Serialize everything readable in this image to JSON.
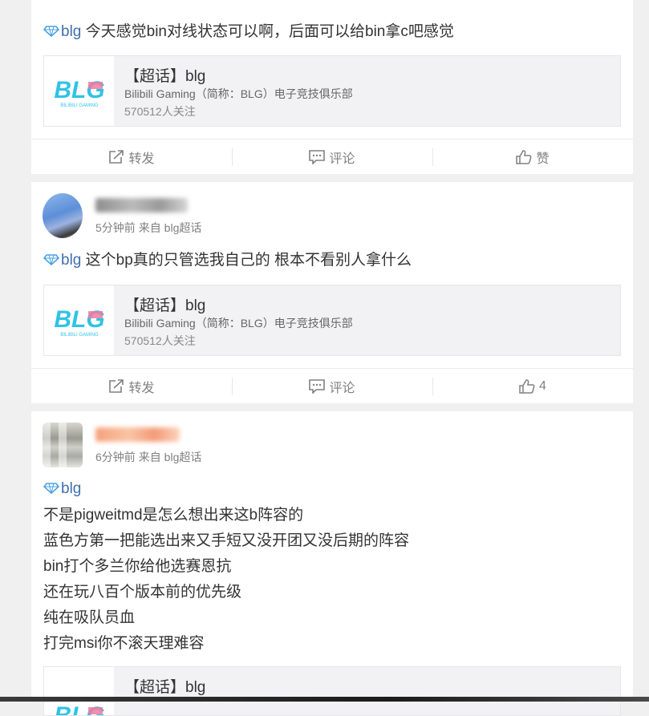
{
  "posts": [
    {
      "topic": "blg",
      "text": "今天感觉bin对线状态可以啊，后面可以给bin拿c吧感觉",
      "share": {
        "title": "【超话】blg",
        "desc": "Bilibili Gaming（简称：BLG）电子竞技俱乐部",
        "count": "570512人关注",
        "logo_text": "BLG",
        "logo_sub": "BILIBILI GAMING"
      },
      "actions": {
        "repost": "转发",
        "comment": "评论",
        "like": "赞"
      }
    },
    {
      "time": "5分钟前",
      "source": "来自 blg超话",
      "topic": "blg",
      "text": "这个bp真的只管选我自己的 根本不看别人拿什么",
      "share": {
        "title": "【超话】blg",
        "desc": "Bilibili Gaming（简称：BLG）电子竞技俱乐部",
        "count": "570512人关注",
        "logo_text": "BLG",
        "logo_sub": "BILIBILI GAMING"
      },
      "actions": {
        "repost": "转发",
        "comment": "评论",
        "like": "4"
      }
    },
    {
      "time": "6分钟前",
      "source": "来自 blg超话",
      "topic": "blg",
      "lines": [
        "不是pigweitmd是怎么想出来这b阵容的",
        "蓝色方第一把能选出来又手短又没开团又没后期的阵容",
        "bin打个多兰你给他选赛恩抗",
        "还在玩八百个版本前的优先级",
        "纯在吸队员血",
        "打完msi你不滚天理难容"
      ],
      "share": {
        "title": "【超话】blg",
        "logo_text": "BLG"
      }
    }
  ],
  "colors": {
    "link": "#3f6fb0",
    "logo_cyan": "#2fc3e6",
    "logo_pink": "#f07aa0"
  },
  "icons": [
    "diamond-icon",
    "repost-icon",
    "comment-icon",
    "like-icon"
  ]
}
